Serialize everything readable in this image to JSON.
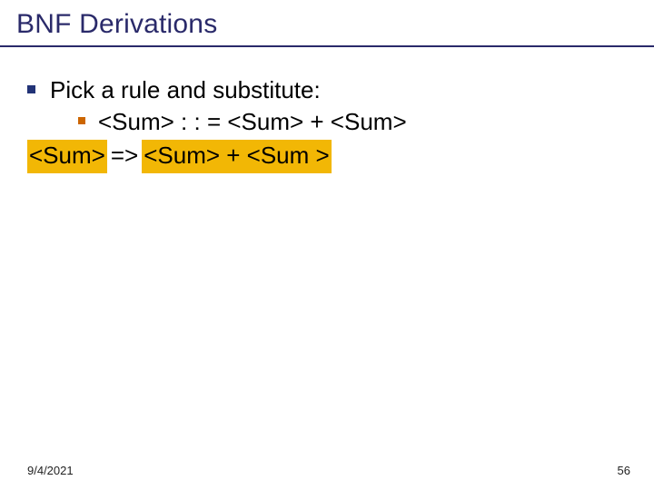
{
  "title": "BNF Derivations",
  "bullet_main": "Pick a rule and substitute:",
  "bullet_sub": "<Sum> : : = <Sum> + <Sum>",
  "deriv_left": "<Sum>",
  "deriv_arrow": "=>",
  "deriv_right": "<Sum> + <Sum >",
  "footer_date": "9/4/2021",
  "footer_page": "56"
}
